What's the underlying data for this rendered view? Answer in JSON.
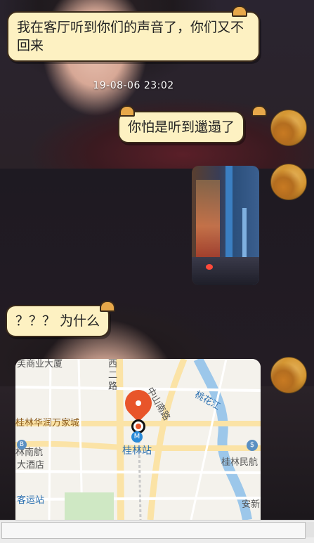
{
  "messages": {
    "first": "我在客厅听到你们的声音了，你们又不回来",
    "timestamp": "19-08-06 23:02",
    "reply": "你怕是听到邋遢了",
    "question": "？？？ 为什么"
  },
  "map": {
    "labels": {
      "top_left": "芙商业大厦",
      "road_xi": "西二路",
      "road_zhongshan": "中山南路",
      "river": "桃花江",
      "mall": "桂林华润万家城",
      "station": "桂林站",
      "hotel_line1": "林南航",
      "hotel_line2": "大酒店",
      "right_place": "桂林民航",
      "bus": "客运站",
      "bottom_right": "安新"
    }
  },
  "icons": {
    "avatar": "dog-avatar",
    "metro": "metro-icon",
    "bank": "bank-icon",
    "bus": "bus-icon"
  }
}
